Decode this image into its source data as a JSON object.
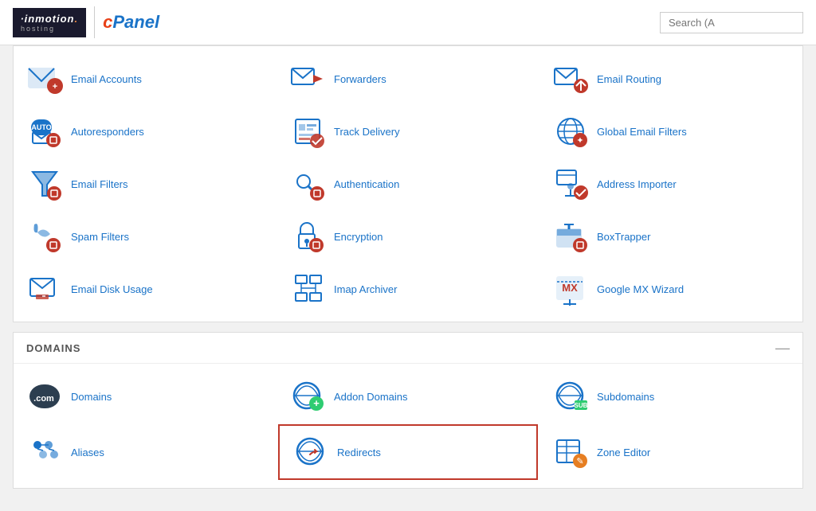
{
  "header": {
    "brand": "inmotion",
    "brand_highlight": ".",
    "brand_sub": "hosting",
    "cpanel": "cPanel",
    "search_placeholder": "Search (A"
  },
  "email_section": {
    "items": [
      {
        "id": "email-accounts",
        "label": "Email Accounts",
        "icon": "email-accounts"
      },
      {
        "id": "forwarders",
        "label": "Forwarders",
        "icon": "forwarders"
      },
      {
        "id": "email-routing",
        "label": "Email Routing",
        "icon": "email-routing"
      },
      {
        "id": "autoresponders",
        "label": "Autoresponders",
        "icon": "autoresponders"
      },
      {
        "id": "track-delivery",
        "label": "Track Delivery",
        "icon": "track-delivery"
      },
      {
        "id": "global-email-filters",
        "label": "Global Email Filters",
        "icon": "global-email-filters"
      },
      {
        "id": "email-filters",
        "label": "Email Filters",
        "icon": "email-filters"
      },
      {
        "id": "authentication",
        "label": "Authentication",
        "icon": "authentication"
      },
      {
        "id": "address-importer",
        "label": "Address Importer",
        "icon": "address-importer"
      },
      {
        "id": "spam-filters",
        "label": "Spam Filters",
        "icon": "spam-filters"
      },
      {
        "id": "encryption",
        "label": "Encryption",
        "icon": "encryption"
      },
      {
        "id": "boxtrapper",
        "label": "BoxTrapper",
        "icon": "boxtrapper"
      },
      {
        "id": "email-disk-usage",
        "label": "Email Disk Usage",
        "icon": "email-disk-usage"
      },
      {
        "id": "imap-archiver",
        "label": "Imap Archiver",
        "icon": "imap-archiver"
      },
      {
        "id": "google-mx-wizard",
        "label": "Google MX Wizard",
        "icon": "google-mx-wizard"
      }
    ]
  },
  "domains_section": {
    "title": "DOMAINS",
    "items": [
      {
        "id": "domains",
        "label": "Domains",
        "icon": "domains"
      },
      {
        "id": "addon-domains",
        "label": "Addon Domains",
        "icon": "addon-domains"
      },
      {
        "id": "subdomains",
        "label": "Subdomains",
        "icon": "subdomains"
      },
      {
        "id": "aliases",
        "label": "Aliases",
        "icon": "aliases"
      },
      {
        "id": "redirects",
        "label": "Redirects",
        "icon": "redirects",
        "highlighted": true
      },
      {
        "id": "zone-editor",
        "label": "Zone Editor",
        "icon": "zone-editor"
      }
    ]
  }
}
